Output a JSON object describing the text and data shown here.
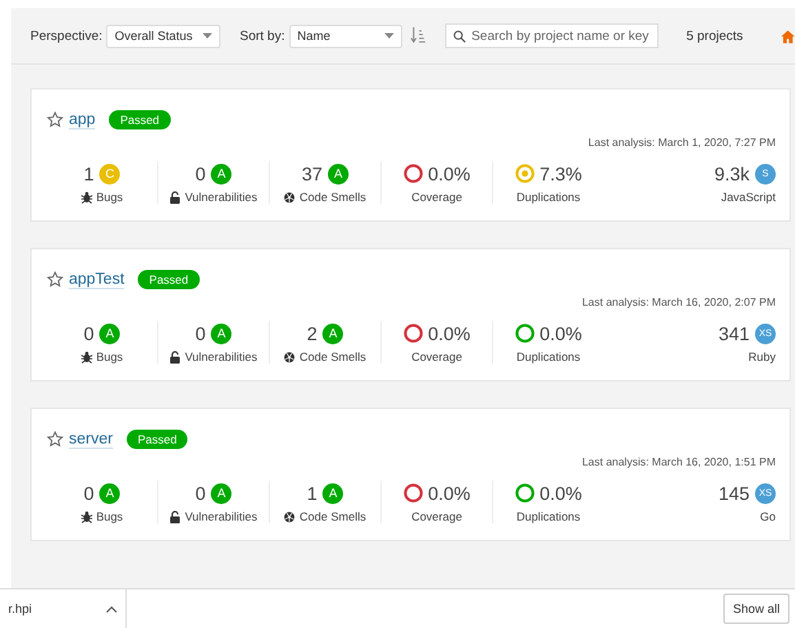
{
  "toolbar": {
    "perspective": {
      "label": "Perspective:",
      "value": "Overall Status"
    },
    "sort": {
      "label": "Sort by:",
      "value": "Name"
    },
    "search": {
      "placeholder": "Search by project name or key"
    },
    "count": "5 projects"
  },
  "projects": [
    {
      "name": "app",
      "status": "Passed",
      "favorite": false,
      "last_analysis": "Last analysis: March 1, 2020, 7:27 PM",
      "bugs": {
        "value": "1",
        "rating": "C",
        "label": "Bugs"
      },
      "vulnerabilities": {
        "value": "0",
        "rating": "A",
        "label": "Vulnerabilities"
      },
      "code_smells": {
        "value": "37",
        "rating": "A",
        "label": "Code Smells"
      },
      "coverage": {
        "value": "0.0%",
        "label": "Coverage",
        "color": "#d4333f"
      },
      "duplications": {
        "value": "7.3%",
        "label": "Duplications",
        "color": "#eabe06",
        "dot": true
      },
      "size": {
        "value": "9.3k",
        "rating": "S",
        "language": "JavaScript"
      }
    },
    {
      "name": "appTest",
      "status": "Passed",
      "favorite": false,
      "last_analysis": "Last analysis: March 16, 2020, 2:07 PM",
      "bugs": {
        "value": "0",
        "rating": "A",
        "label": "Bugs"
      },
      "vulnerabilities": {
        "value": "0",
        "rating": "A",
        "label": "Vulnerabilities"
      },
      "code_smells": {
        "value": "2",
        "rating": "A",
        "label": "Code Smells"
      },
      "coverage": {
        "value": "0.0%",
        "label": "Coverage",
        "color": "#d4333f"
      },
      "duplications": {
        "value": "0.0%",
        "label": "Duplications",
        "color": "#00aa00",
        "dot": false
      },
      "size": {
        "value": "341",
        "rating": "XS",
        "language": "Ruby"
      }
    },
    {
      "name": "server",
      "status": "Passed",
      "favorite": false,
      "last_analysis": "Last analysis: March 16, 2020, 1:51 PM",
      "bugs": {
        "value": "0",
        "rating": "A",
        "label": "Bugs"
      },
      "vulnerabilities": {
        "value": "0",
        "rating": "A",
        "label": "Vulnerabilities"
      },
      "code_smells": {
        "value": "1",
        "rating": "A",
        "label": "Code Smells"
      },
      "coverage": {
        "value": "0.0%",
        "label": "Coverage",
        "color": "#d4333f"
      },
      "duplications": {
        "value": "0.0%",
        "label": "Duplications",
        "color": "#00aa00",
        "dot": false
      },
      "size": {
        "value": "145",
        "rating": "XS",
        "language": "Go"
      }
    }
  ],
  "download_bar": {
    "file": "r.hpi",
    "button": "Show all"
  }
}
